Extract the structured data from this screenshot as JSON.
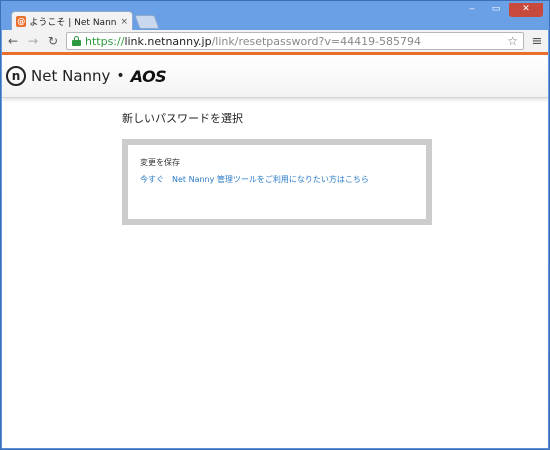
{
  "browser": {
    "tab": {
      "title": "ようこそ | Net Nanny イン",
      "close_glyph": "×",
      "favicon_glyph": "@"
    },
    "window_controls": {
      "minimize": "‒",
      "maximize": "▭",
      "close": "✕"
    },
    "toolbar": {
      "back_glyph": "←",
      "forward_glyph": "→",
      "reload_glyph": "↻",
      "star_glyph": "☆",
      "menu_glyph": "≡"
    },
    "address": {
      "scheme": "https://",
      "host": "link.netnanny.jp",
      "path": "/link/resetpassword?v=44419-585794"
    }
  },
  "site": {
    "logo_mark": "n",
    "logo_text": "Net Nanny",
    "logo_separator": "•",
    "logo_aos": "AOS",
    "accent_color": "#e8702a"
  },
  "main": {
    "title": "新しいパスワードを選択",
    "card": {
      "status": "変更を保存",
      "link_text": "今すぐ　Net Nanny 管理ツールをご利用になりたい方はこちら",
      "link_color": "#2a7bc6"
    }
  },
  "icons": [
    "favicon-icon",
    "close-icon",
    "back-icon",
    "forward-icon",
    "reload-icon",
    "lock-icon",
    "star-icon",
    "menu-icon",
    "logo-icon"
  ]
}
